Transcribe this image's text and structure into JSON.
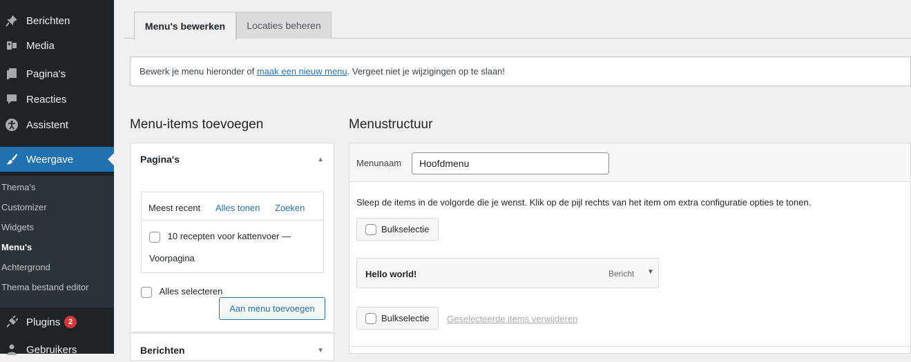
{
  "sidebar": {
    "items": [
      {
        "label": "Berichten",
        "icon": "pin-icon"
      },
      {
        "label": "Media",
        "icon": "media-icon"
      },
      {
        "label": "Pagina's",
        "icon": "page-icon"
      },
      {
        "label": "Reacties",
        "icon": "comment-icon"
      },
      {
        "label": "Assistent",
        "icon": "accessibility-icon"
      },
      {
        "label": "Weergave",
        "icon": "brush-icon"
      }
    ],
    "submenu": [
      "Thema's",
      "Customizer",
      "Widgets",
      "Menu's",
      "Achtergrond",
      "Thema bestand editor"
    ],
    "plugins": {
      "label": "Plugins",
      "badge": "2"
    },
    "users": {
      "label": "Gebruikers"
    }
  },
  "tabs": {
    "edit": "Menu's bewerken",
    "locations": "Locaties beheren"
  },
  "notice": {
    "before": "Bewerk je menu hieronder of ",
    "link": "maak een nieuw menu",
    "after": ". Vergeet niet je wijzigingen op te slaan!"
  },
  "left": {
    "heading": "Menu-items toevoegen",
    "pages": {
      "title": "Pagina's",
      "tabs": [
        "Meest recent",
        "Alles tonen",
        "Zoeken"
      ],
      "item_title": "10 recepten voor kattenvoer —",
      "item_sub": "Voorpagina",
      "select_all": "Alles selecteren",
      "add_button": "Aan menu toevoegen"
    },
    "posts": {
      "title": "Berichten"
    }
  },
  "right": {
    "heading": "Menustructuur",
    "menu_name_label": "Menunaam",
    "menu_name_value": "Hoofdmenu",
    "instructions": "Sleep de items in de volgorde die je wenst. Klik op de pijl rechts van het item om extra configuratie opties te tonen.",
    "bulk_label": "Bulkselectie",
    "menu_item": {
      "title": "Hello world!",
      "type": "Bericht"
    },
    "remove_selected": "Geselecteerde items verwijderen"
  },
  "colors": {
    "accent": "#2271b1",
    "sidebar_bg": "#1d2327",
    "badge": "#d63638"
  }
}
